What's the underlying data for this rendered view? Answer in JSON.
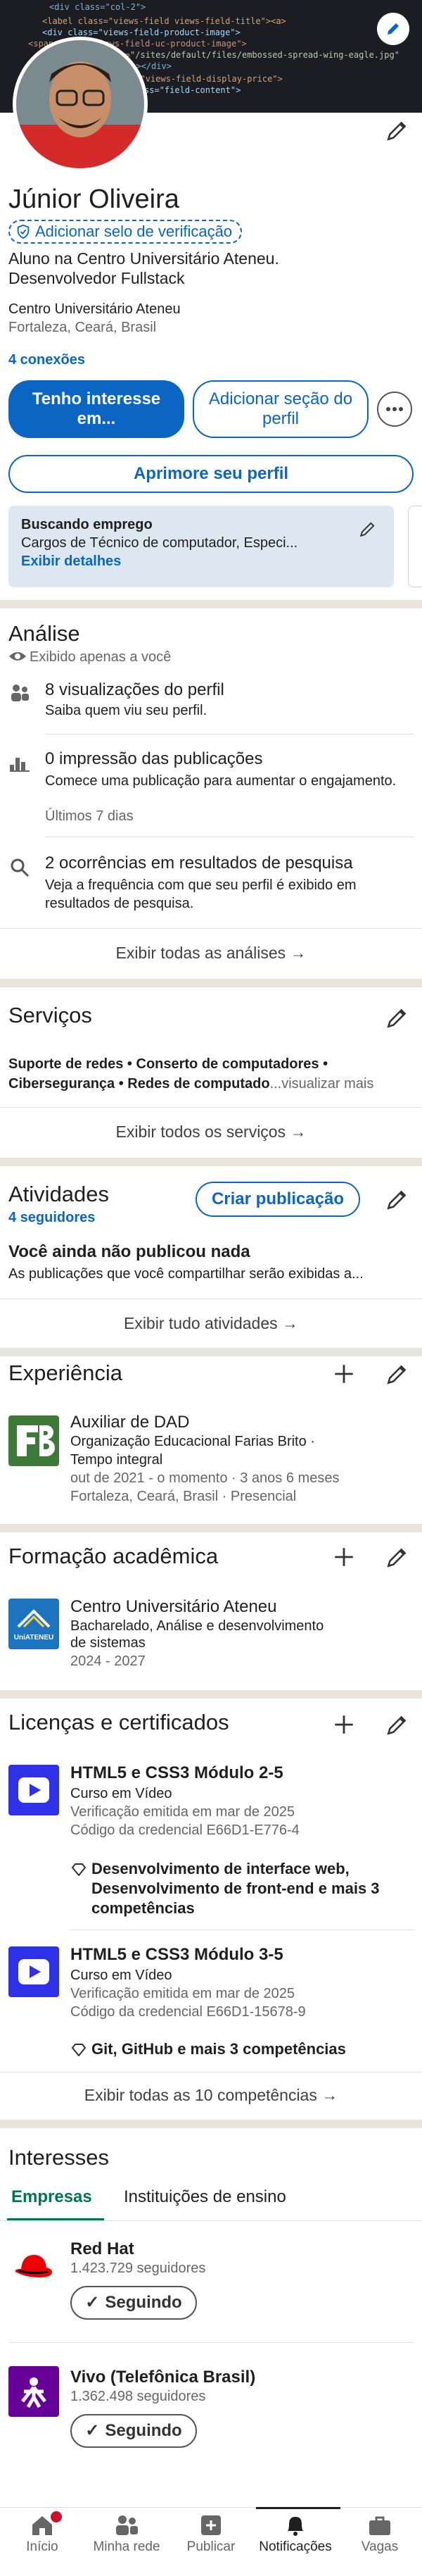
{
  "profile": {
    "name": "Júnior Oliveira",
    "verify_label": "Adicionar selo de verificação",
    "headline_1": "Aluno na Centro Universitário Ateneu.",
    "headline_2": "Desenvolvedor Fullstack",
    "institution": "Centro Universitário Ateneu",
    "location": "Fortaleza, Ceará, Brasil",
    "connections": "4 conexões",
    "btn_interest": "Tenho interesse em...",
    "btn_add_section": "Adicionar seção do perfil",
    "btn_improve": "Aprimore seu perfil",
    "open_to_work_title": "Buscando emprego",
    "open_to_work_desc": "Cargos de Técnico de computador, Especi...",
    "open_to_work_link": "Exibir detalhes"
  },
  "analytics": {
    "title": "Análise",
    "visibility": "Exibido apenas a você",
    "items": [
      {
        "title": "8 visualizações do perfil",
        "desc": "Saiba quem viu seu perfil.",
        "icon": "people-icon"
      },
      {
        "title": "0 impressão das publicações",
        "desc": "Comece uma publicação para aumentar o engajamento.",
        "sub": "Últimos 7 dias",
        "icon": "bar-chart-icon"
      },
      {
        "title": "2 ocorrências em resultados de pesquisa",
        "desc": "Veja a frequência com que seu perfil é exibido em resultados de pesquisa.",
        "icon": "search-icon"
      }
    ],
    "footer": "Exibir todas as análises →"
  },
  "services": {
    "title": "Serviços",
    "line_1": "Suporte de redes • Conserto de computadores •",
    "line_2": "Cibersegurança • Redes de computado",
    "more": "...visualizar mais",
    "footer": "Exibir todos os serviços →"
  },
  "activity": {
    "title": "Atividades",
    "followers": "4 seguidores",
    "btn_create": "Criar publicação",
    "empty_title": "Você ainda não publicou nada",
    "empty_desc": "As publicações que você compartilhar serão exibidas a...",
    "footer": "Exibir tudo atividades →"
  },
  "experience": {
    "title": "Experiência",
    "items": [
      {
        "role": "Auxiliar de DAD",
        "org": "Organização Educacional Farias Brito ·",
        "type": "Tempo integral",
        "dates": "out de 2021 - o momento · 3 anos 6 meses",
        "place": "Fortaleza, Ceará, Brasil · Presencial",
        "color": "#3d7a3a"
      }
    ]
  },
  "education": {
    "title": "Formação acadêmica",
    "items": [
      {
        "school": "Centro Universitário Ateneu",
        "degree_1": "Bacharelado, Análise e desenvolvimento",
        "degree_2": "de sistemas",
        "years": "2024 - 2027",
        "logo_text": "UniATENEU",
        "color": "#1e73be"
      }
    ]
  },
  "licenses": {
    "title": "Licenças e certificados",
    "items": [
      {
        "name": "HTML5 e CSS3 Módulo 2-5",
        "issuer": "Curso em Vídeo",
        "issued": "Verificação emitida em mar de 2025",
        "credential": "Código da credencial E66D1-E776-4",
        "skills_1": "Desenvolvimento de interface web,",
        "skills_2": "Desenvolvimento de front-end e mais 3",
        "skills_3": "competências"
      },
      {
        "name": "HTML5 e CSS3 Módulo 3-5",
        "issuer": "Curso em Vídeo",
        "issued": "Verificação emitida em mar de 2025",
        "credential": "Código da credencial E66D1-15678-9",
        "skills_1": "Git, GitHub e mais 3 competências"
      }
    ],
    "footer": "Exibir todas as 10 competências →"
  },
  "interests": {
    "title": "Interesses",
    "tabs": [
      "Empresas",
      "Instituições de ensino"
    ],
    "items": [
      {
        "name": "Red Hat",
        "followers": "1.423.729 seguidores",
        "btn": "Seguindo",
        "color": "#ee0000"
      },
      {
        "name": "Vivo (Telefônica Brasil)",
        "followers": "1.362.498 seguidores",
        "btn": "Seguindo",
        "color": "#660099"
      }
    ]
  },
  "nav": {
    "items": [
      "Início",
      "Minha rede",
      "Publicar",
      "Notificações",
      "Vagas"
    ],
    "active": "Notificações"
  },
  "colors": {
    "accent": "#0a66c2",
    "separator": "#e8e4dc",
    "green_tab": "#01754f"
  }
}
